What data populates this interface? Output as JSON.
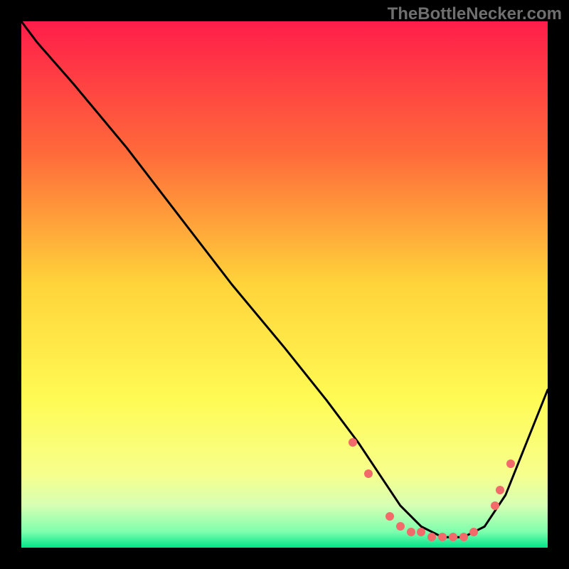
{
  "watermark": "TheBottleNecker.com",
  "colors": {
    "dot": "#f26a6a",
    "curve": "#000000",
    "bg": "#000000"
  },
  "gradient_stops": [
    {
      "pct": 0,
      "color": "#ff1d4a"
    },
    {
      "pct": 25,
      "color": "#ff6a3a"
    },
    {
      "pct": 50,
      "color": "#ffd43a"
    },
    {
      "pct": 72,
      "color": "#fffb55"
    },
    {
      "pct": 86,
      "color": "#f7ff8c"
    },
    {
      "pct": 92,
      "color": "#d6ffb4"
    },
    {
      "pct": 97,
      "color": "#7dffad"
    },
    {
      "pct": 100,
      "color": "#00e38a"
    }
  ],
  "chart_data": {
    "type": "line",
    "title": "",
    "xlabel": "",
    "ylabel": "",
    "xlim": [
      0,
      100
    ],
    "ylim": [
      0,
      100
    ],
    "x": [
      0,
      3,
      10,
      20,
      30,
      40,
      50,
      58,
      64,
      68,
      72,
      76,
      80,
      84,
      88,
      92,
      96,
      100
    ],
    "y": [
      100,
      96,
      88,
      76,
      63,
      50,
      38,
      28,
      20,
      14,
      8,
      4,
      2,
      2,
      4,
      10,
      20,
      30
    ],
    "markers": {
      "x": [
        63,
        66,
        70,
        72,
        74,
        76,
        78,
        80,
        82,
        84,
        86,
        90,
        91,
        93
      ],
      "y": [
        20,
        14,
        6,
        4,
        3,
        3,
        2,
        2,
        2,
        2,
        3,
        8,
        11,
        16
      ]
    },
    "note": "y is drawn with 0 at the bottom (higher y = higher on screen). Values are estimates read from the figure pixels."
  }
}
